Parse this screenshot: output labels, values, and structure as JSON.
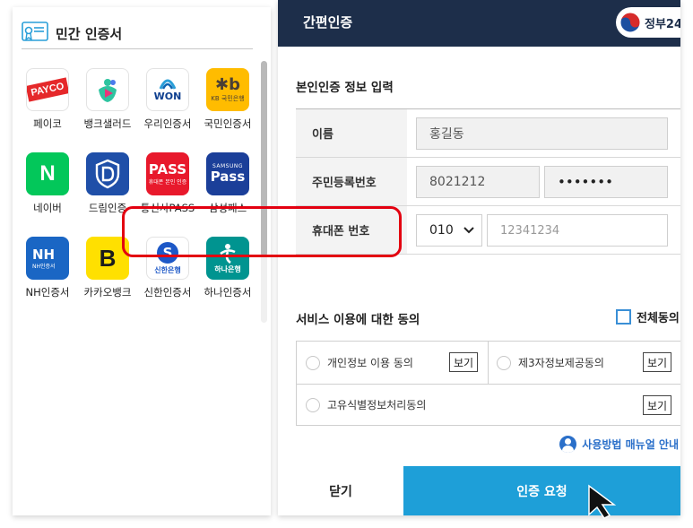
{
  "left_panel": {
    "title": "민간 인증서",
    "apps": [
      {
        "label": "페이코",
        "icon": "payco-icon",
        "brand_text": "PAYCO",
        "color": "#ffffff"
      },
      {
        "label": "뱅크샐러드",
        "icon": "banksalad-icon",
        "color": "#ffffff"
      },
      {
        "label": "우리인증서",
        "icon": "woori-won-icon",
        "brand_text": "WON",
        "color": "#ffffff"
      },
      {
        "label": "국민인증서",
        "icon": "kb-icon",
        "brand_text": "KB 국민은행",
        "color": "#ffbc00"
      },
      {
        "label": "네이버",
        "icon": "naver-icon",
        "brand_text": "N",
        "color": "#03c75a"
      },
      {
        "label": "드림인증",
        "icon": "dream-shield-icon",
        "color": "#1f4fa8"
      },
      {
        "label": "통신사PASS",
        "icon": "pass-icon",
        "brand_text": "PASS",
        "brand_sub": "휴대폰 본인 인증",
        "color": "#e8192c"
      },
      {
        "label": "삼성패스",
        "icon": "samsung-pass-icon",
        "brand_text": "Pass",
        "brand_sub": "SAMSUNG",
        "color": "#1b3f99"
      },
      {
        "label": "NH인증서",
        "icon": "nh-icon",
        "brand_text": "NH",
        "brand_sub": "NH인증서",
        "color": "#1a66c4"
      },
      {
        "label": "카카오뱅크",
        "icon": "kakaobank-icon",
        "brand_text": "B",
        "color": "#ffe000"
      },
      {
        "label": "신한인증서",
        "icon": "shinhan-icon",
        "brand_text": "S",
        "brand_sub": "신한은행",
        "color": "#ffffff"
      },
      {
        "label": "하나인증서",
        "icon": "hana-icon",
        "brand_text": "하나은행",
        "color": "#009490"
      }
    ]
  },
  "right_panel": {
    "header_title": "간편인증",
    "gov_logo_text": "정부24",
    "section_title": "본인인증 정보 입력",
    "name_label": "이름",
    "name_value": "홍길동",
    "rrn_label": "주민등록번호",
    "rrn_front": "8021212",
    "rrn_back": "•••••••",
    "phone_label": "휴대폰 번호",
    "phone_prefix": "010",
    "phone_number_placeholder": "12341234",
    "consent_title": "서비스 이용에 대한 동의",
    "all_consent_label": "전체동의",
    "consents": [
      {
        "label": "개인정보 이용 동의",
        "view": "보기"
      },
      {
        "label": "제3자정보제공동의",
        "view": "보기"
      },
      {
        "label": "고유식별정보처리동의",
        "view": "보기"
      }
    ],
    "manual_link": "사용방법 매뉴얼 안내",
    "close_button": "닫기",
    "auth_button": "인증 요청",
    "accent_color": "#1e9fd8",
    "header_color": "#1d2e4a",
    "highlight_color": "#e30010"
  }
}
